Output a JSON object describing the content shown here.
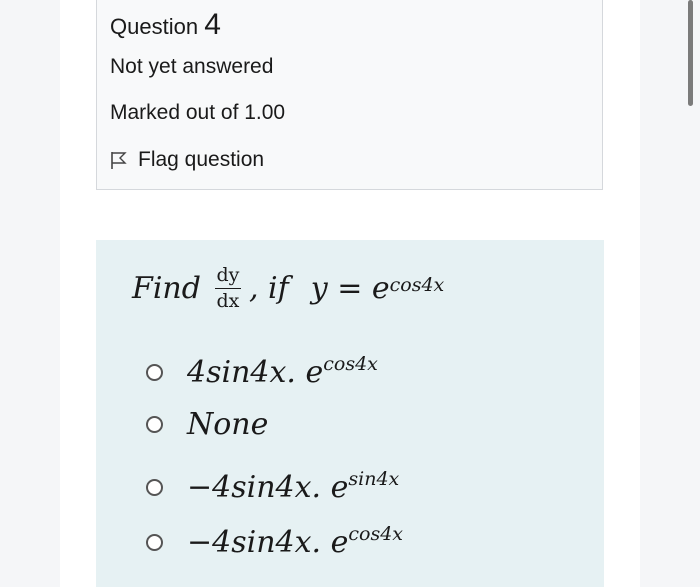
{
  "question": {
    "title_word": "Question",
    "number": "4",
    "status": "Not yet answered",
    "marked": "Marked out of 1.00",
    "flag_label": "Flag question"
  },
  "prompt": {
    "find": "Find",
    "frac_num": "dy",
    "frac_den": "dx",
    "comma_if": ", if",
    "equation_lhs": "y = e",
    "exponent": "cos4x"
  },
  "options": [
    {
      "base": "4sin4x. e",
      "exp": "cos4x"
    },
    {
      "base": "None",
      "exp": ""
    },
    {
      "base": "−4sin4x. e",
      "exp": "sin4x"
    },
    {
      "base": "−4sin4x. e",
      "exp": "cos4x"
    }
  ],
  "colors": {
    "content_bg": "#e6f1f3",
    "info_bg": "#f8f9fa",
    "page_bg": "#f5f6f8"
  }
}
